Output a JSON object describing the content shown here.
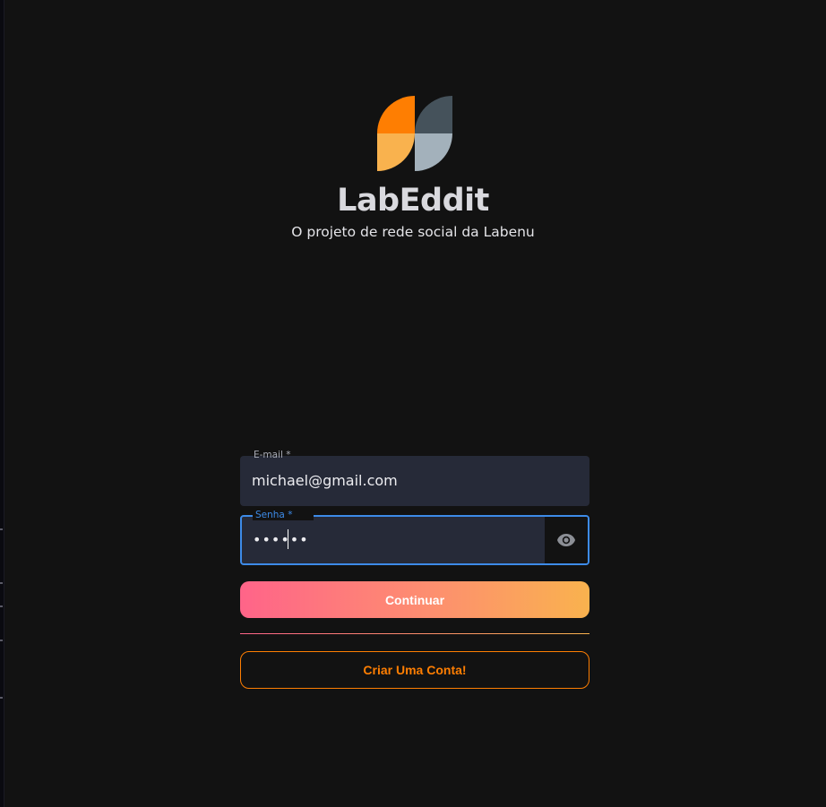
{
  "brand": {
    "title": "LabEddit",
    "subtitle": "O projeto de rede social da Labenu",
    "logo_colors": {
      "orange_dark": "#FE7E02",
      "orange_light": "#F9B24E",
      "slate_dark": "#45525B",
      "slate_light": "#A3B1BB"
    }
  },
  "form": {
    "email": {
      "label": "E-mail *",
      "value": "michael@gmail.com"
    },
    "password": {
      "label": "Senha *",
      "value": "••••••",
      "toggle_icon": "eye-icon",
      "focused": true
    },
    "continue_label": "Continuar",
    "create_account_label": "Criar Uma Conta!"
  },
  "colors": {
    "background": "#121212",
    "field_background": "#262A38",
    "focus_accent": "#3D8BE8",
    "gradient_start": "#FF6489",
    "gradient_end": "#F9B24E",
    "outline_orange": "#FE7E02"
  }
}
